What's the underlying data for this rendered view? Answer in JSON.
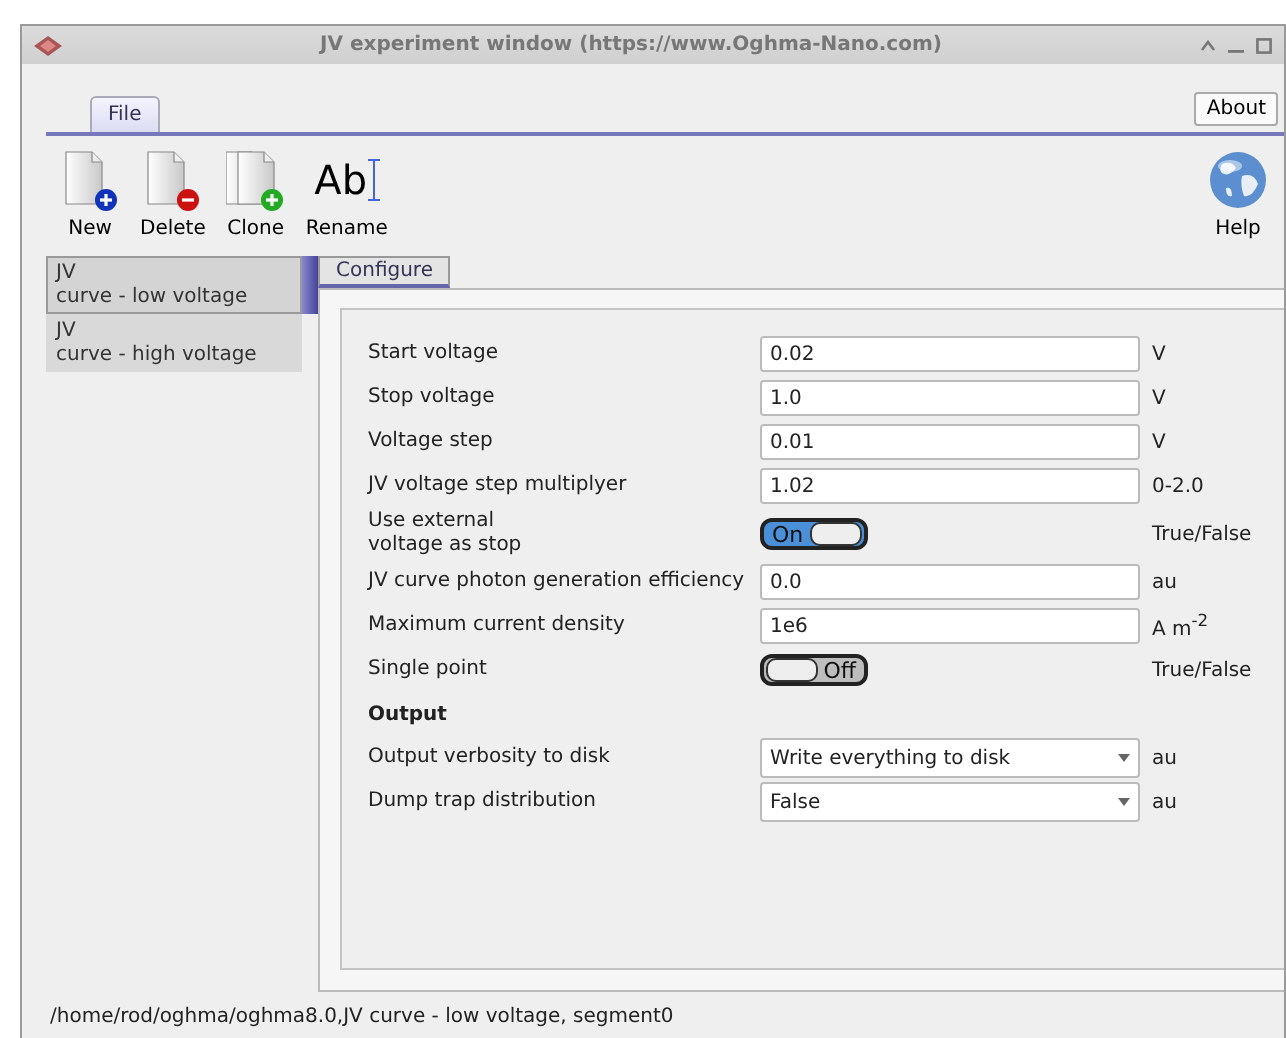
{
  "window": {
    "title": "JV experiment window (https://www.Oghma-Nano.com)"
  },
  "menu_tabs": [
    {
      "label": "File",
      "selected": true
    }
  ],
  "about_button": "About",
  "toolbar": [
    {
      "kind": "new",
      "label": "New"
    },
    {
      "kind": "delete",
      "label": "Delete"
    },
    {
      "kind": "clone",
      "label": "Clone"
    },
    {
      "kind": "rename",
      "label": "Rename",
      "icon_text": "Ab"
    }
  ],
  "help_button": "Help",
  "sidebar": {
    "items": [
      {
        "title": "JV",
        "subtitle": "curve - low voltage",
        "selected": true
      },
      {
        "title": "JV",
        "subtitle": "curve - high voltage",
        "selected": false
      }
    ]
  },
  "panel_tabs": [
    {
      "label": "Configure",
      "selected": true
    }
  ],
  "rows": [
    {
      "kind": "field",
      "label": "Start voltage",
      "value": "0.02",
      "unit": "V"
    },
    {
      "kind": "field",
      "label": "Stop voltage",
      "value": "1.0",
      "unit": "V"
    },
    {
      "kind": "field",
      "label": "Voltage step",
      "value": "0.01",
      "unit": "V"
    },
    {
      "kind": "field",
      "label": "JV voltage step multiplyer",
      "value": "1.02",
      "unit": "0-2.0"
    },
    {
      "kind": "switch",
      "label": "Use external\nvoltage as stop",
      "on": true,
      "text": "On",
      "unit": "True/False"
    },
    {
      "kind": "field",
      "label": "JV curve photon generation efficiency",
      "value": "0.0",
      "unit": "au"
    },
    {
      "kind": "field",
      "label": "Maximum current density",
      "value": "1e6",
      "unit": "A m$^{-2}$"
    },
    {
      "kind": "switch",
      "label": "Single point",
      "on": false,
      "text": "Off",
      "unit": "True/False"
    },
    {
      "kind": "heading",
      "label": "Output"
    },
    {
      "kind": "combo",
      "label": "Output verbosity to disk",
      "value": "Write everything to disk",
      "unit": "au"
    },
    {
      "kind": "combo",
      "label": "Dump trap distribution",
      "value": "False",
      "unit": "au"
    }
  ],
  "status_bar": "/home/rod/oghma/oghma8.0,JV curve - low voltage, segment0"
}
